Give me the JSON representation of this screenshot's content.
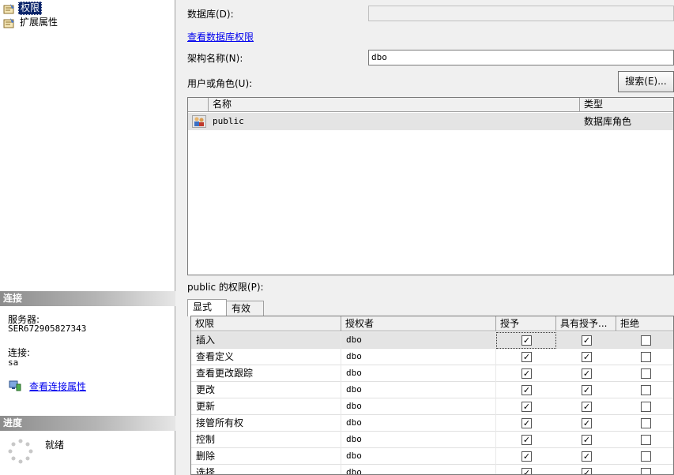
{
  "left_nav": {
    "items": [
      {
        "label": "权限",
        "selected": true
      },
      {
        "label": "扩展属性",
        "selected": false
      }
    ]
  },
  "connection": {
    "header": "连接",
    "server_label": "服务器:",
    "server_value": "SER672905827343",
    "conn_label": "连接:",
    "conn_value": "sa",
    "view_props_link": "查看连接属性"
  },
  "progress": {
    "header": "进度",
    "status": "就绪"
  },
  "form": {
    "database_label": "数据库(D):",
    "database_value": "",
    "view_db_perms_link": "查看数据库权限",
    "schema_label": "架构名称(N):",
    "schema_value": "dbo",
    "users_label": "用户或角色(U):",
    "search_button": "搜索(E)..."
  },
  "users_grid": {
    "col_name": "名称",
    "col_type": "类型",
    "rows": [
      {
        "name": "public",
        "type": "数据库角色"
      }
    ]
  },
  "perms": {
    "label": "public 的权限(P):",
    "tabs": [
      "显式",
      "有效"
    ],
    "columns": [
      "权限",
      "授权者",
      "授予",
      "具有授予...",
      "拒绝"
    ],
    "rows": [
      {
        "perm": "插入",
        "grantor": "dbo",
        "grant": true,
        "with_grant": true,
        "deny": false
      },
      {
        "perm": "查看定义",
        "grantor": "dbo",
        "grant": true,
        "with_grant": true,
        "deny": false
      },
      {
        "perm": "查看更改跟踪",
        "grantor": "dbo",
        "grant": true,
        "with_grant": true,
        "deny": false
      },
      {
        "perm": "更改",
        "grantor": "dbo",
        "grant": true,
        "with_grant": true,
        "deny": false
      },
      {
        "perm": "更新",
        "grantor": "dbo",
        "grant": true,
        "with_grant": true,
        "deny": false
      },
      {
        "perm": "接管所有权",
        "grantor": "dbo",
        "grant": true,
        "with_grant": true,
        "deny": false
      },
      {
        "perm": "控制",
        "grantor": "dbo",
        "grant": true,
        "with_grant": true,
        "deny": false
      },
      {
        "perm": "删除",
        "grantor": "dbo",
        "grant": true,
        "with_grant": true,
        "deny": false
      },
      {
        "perm": "选择",
        "grantor": "dbo",
        "grant": true,
        "with_grant": true,
        "deny": false
      }
    ]
  }
}
